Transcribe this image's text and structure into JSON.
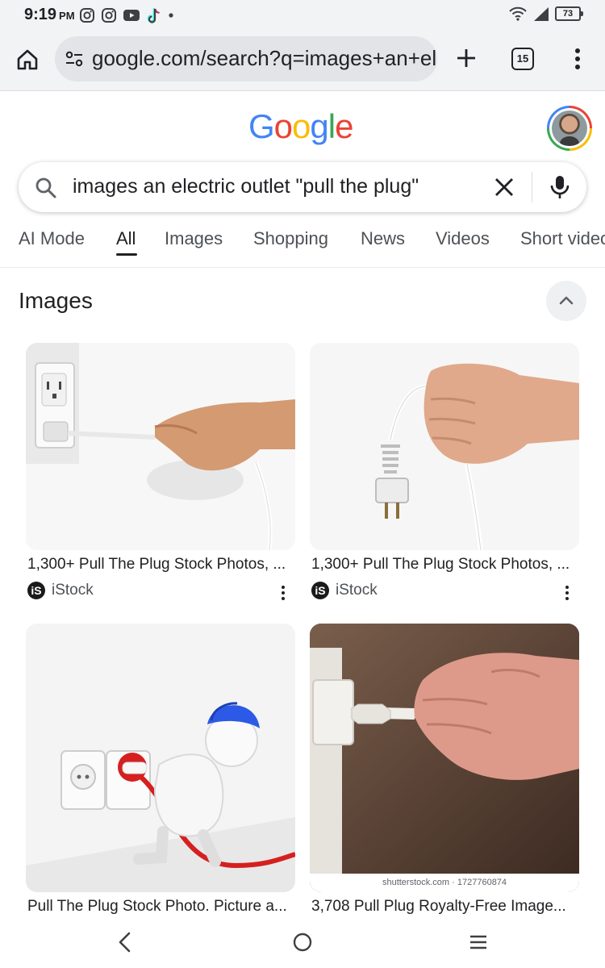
{
  "status_bar": {
    "time": "9:19",
    "ampm": "PM",
    "battery": "73",
    "app_icons": [
      "instagram-icon",
      "instagram-icon",
      "youtube-icon",
      "tiktok-icon",
      "dot-icon"
    ],
    "system_icons": [
      "wifi-icon",
      "signal-icon",
      "battery-icon"
    ]
  },
  "browser": {
    "url": "google.com/search?q=images+an+electric+outlet",
    "tab_count": "15"
  },
  "google": {
    "logo_letters": [
      "G",
      "o",
      "o",
      "g",
      "l",
      "e"
    ],
    "logo_colors": [
      "#4285F4",
      "#EA4335",
      "#FBBC05",
      "#4285F4",
      "#34A853",
      "#EA4335"
    ]
  },
  "search": {
    "query": "images an electric outlet \"pull the plug\""
  },
  "tabs": [
    {
      "label": "AI Mode"
    },
    {
      "label": "All"
    },
    {
      "label": "Images"
    },
    {
      "label": "Shopping"
    },
    {
      "label": "News"
    },
    {
      "label": "Videos"
    },
    {
      "label": "Short videos"
    }
  ],
  "images_section": {
    "title": "Images",
    "results": [
      {
        "title": "1,300+ Pull The Plug Stock Photos, ...",
        "source": "iStock",
        "source_logo": "iS"
      },
      {
        "title": "1,300+ Pull The Plug Stock Photos, ...",
        "source": "iStock",
        "source_logo": "iS"
      },
      {
        "title": "Pull The Plug Stock Photo. Picture a...",
        "source": "",
        "source_logo": ""
      },
      {
        "title": "3,708 Pull Plug Royalty-Free Image...",
        "source": "",
        "source_logo": "",
        "watermark": "shutterstock.com · 1727760874"
      }
    ]
  },
  "colors": {
    "accent_blue": "#4285F4",
    "text_primary": "#202124",
    "text_secondary": "#4d5156",
    "chrome_bg": "#f1f3f4"
  }
}
